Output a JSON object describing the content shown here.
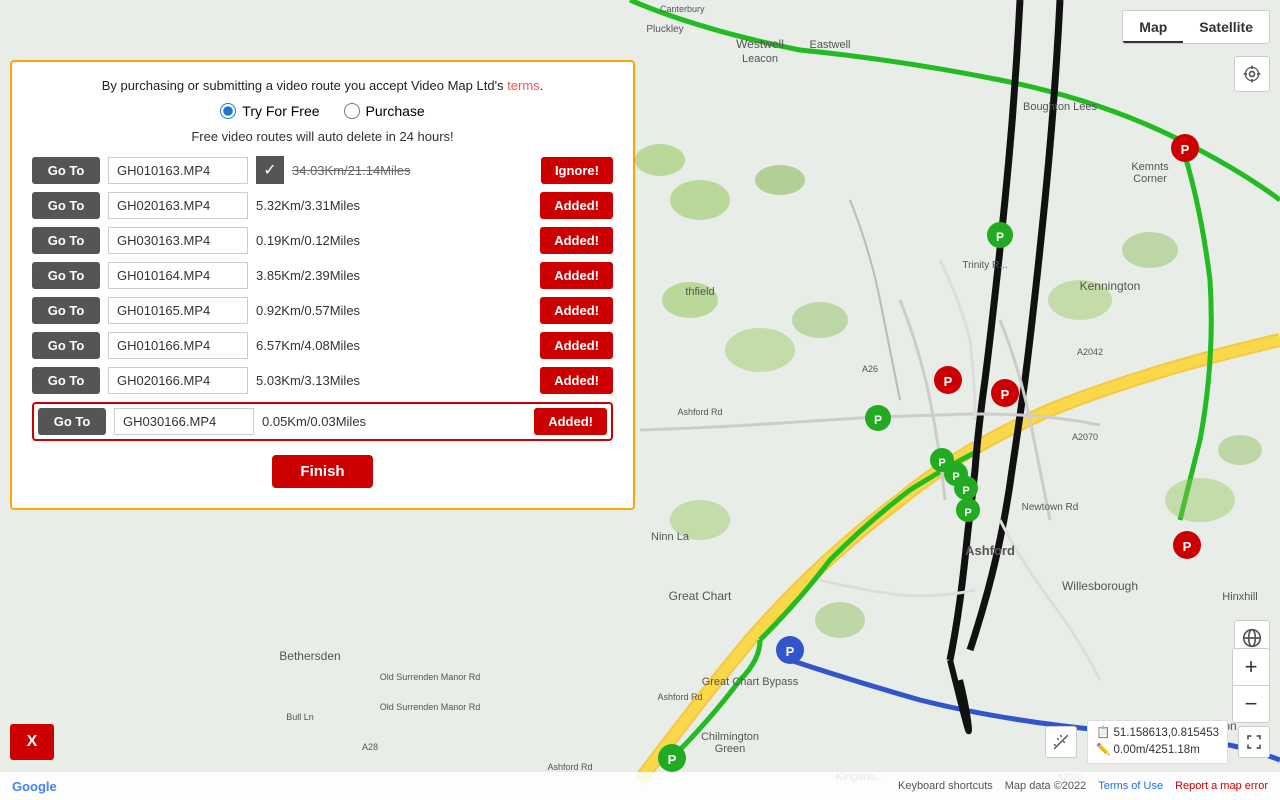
{
  "map": {
    "type_active": "Map",
    "type_options": [
      "Map",
      "Satellite"
    ],
    "coords": "51.158613,0.815453",
    "distance": "0.00m/4251.18m",
    "attribution": "Map data ©2022",
    "keyboard_shortcuts": "Keyboard shortcuts",
    "terms_of_use": "Terms of Use",
    "report_error": "Report a map error",
    "google": "Google"
  },
  "panel": {
    "terms_text": "By purchasing or submitting a video route you accept Video Map Ltd's",
    "terms_link": "terms",
    "terms_end": ".",
    "radio_free": "Try For Free",
    "radio_purchase": "Purchase",
    "free_note": "Free video routes will auto delete in 24 hours!",
    "finish_label": "Finish"
  },
  "routes": [
    {
      "id": 1,
      "filename": "GH010163.MP4",
      "distance": "34.03Km/21.14Miles",
      "action": "Ignore!",
      "checked": true,
      "strikethrough": true,
      "highlighted": false
    },
    {
      "id": 2,
      "filename": "GH020163.MP4",
      "distance": "5.32Km/3.31Miles",
      "action": "Added!",
      "checked": false,
      "strikethrough": false,
      "highlighted": false
    },
    {
      "id": 3,
      "filename": "GH030163.MP4",
      "distance": "0.19Km/0.12Miles",
      "action": "Added!",
      "checked": false,
      "strikethrough": false,
      "highlighted": false
    },
    {
      "id": 4,
      "filename": "GH010164.MP4",
      "distance": "3.85Km/2.39Miles",
      "action": "Added!",
      "checked": false,
      "strikethrough": false,
      "highlighted": false
    },
    {
      "id": 5,
      "filename": "GH010165.MP4",
      "distance": "0.92Km/0.57Miles",
      "action": "Added!",
      "checked": false,
      "strikethrough": false,
      "highlighted": false
    },
    {
      "id": 6,
      "filename": "GH010166.MP4",
      "distance": "6.57Km/4.08Miles",
      "action": "Added!",
      "checked": false,
      "strikethrough": false,
      "highlighted": false
    },
    {
      "id": 7,
      "filename": "GH020166.MP4",
      "distance": "5.03Km/3.13Miles",
      "action": "Added!",
      "checked": false,
      "strikethrough": false,
      "highlighted": false
    },
    {
      "id": 8,
      "filename": "GH030166.MP4",
      "distance": "0.05Km/0.03Miles",
      "action": "Added!",
      "checked": false,
      "strikethrough": false,
      "highlighted": true
    }
  ],
  "goto_label": "Go To",
  "x_label": "X"
}
